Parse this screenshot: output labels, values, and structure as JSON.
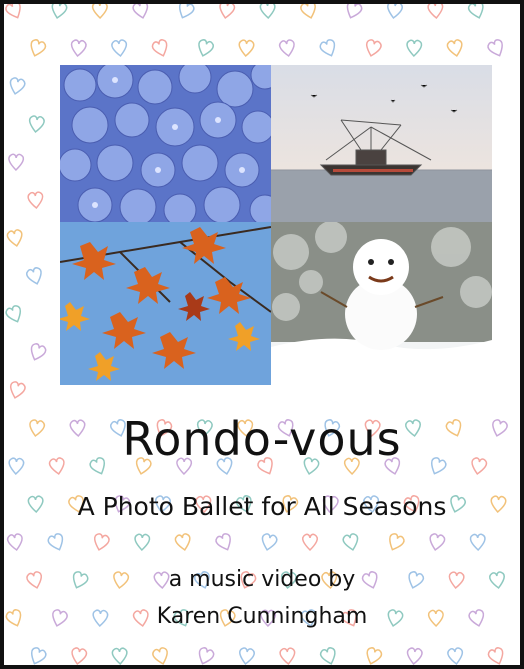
{
  "poster": {
    "title": "Rondo-vous",
    "subtitle": "A Photo Ballet for All Seasons",
    "credit_line1": "a music video by",
    "credit_line2": "Karen Cunningham"
  },
  "photos": [
    {
      "season": "spring",
      "subject": "blue hydrangea flowers"
    },
    {
      "season": "summer",
      "subject": "fishing boat at sea"
    },
    {
      "season": "autumn",
      "subject": "orange maple leaves"
    },
    {
      "season": "winter",
      "subject": "snowman in snow"
    }
  ],
  "colors": {
    "border": "#111111",
    "background": "#ffffff",
    "heart_palette": [
      "#f4a7a0",
      "#8fc9c0",
      "#f2c27a",
      "#c9a9d9",
      "#9fc3e6"
    ]
  }
}
